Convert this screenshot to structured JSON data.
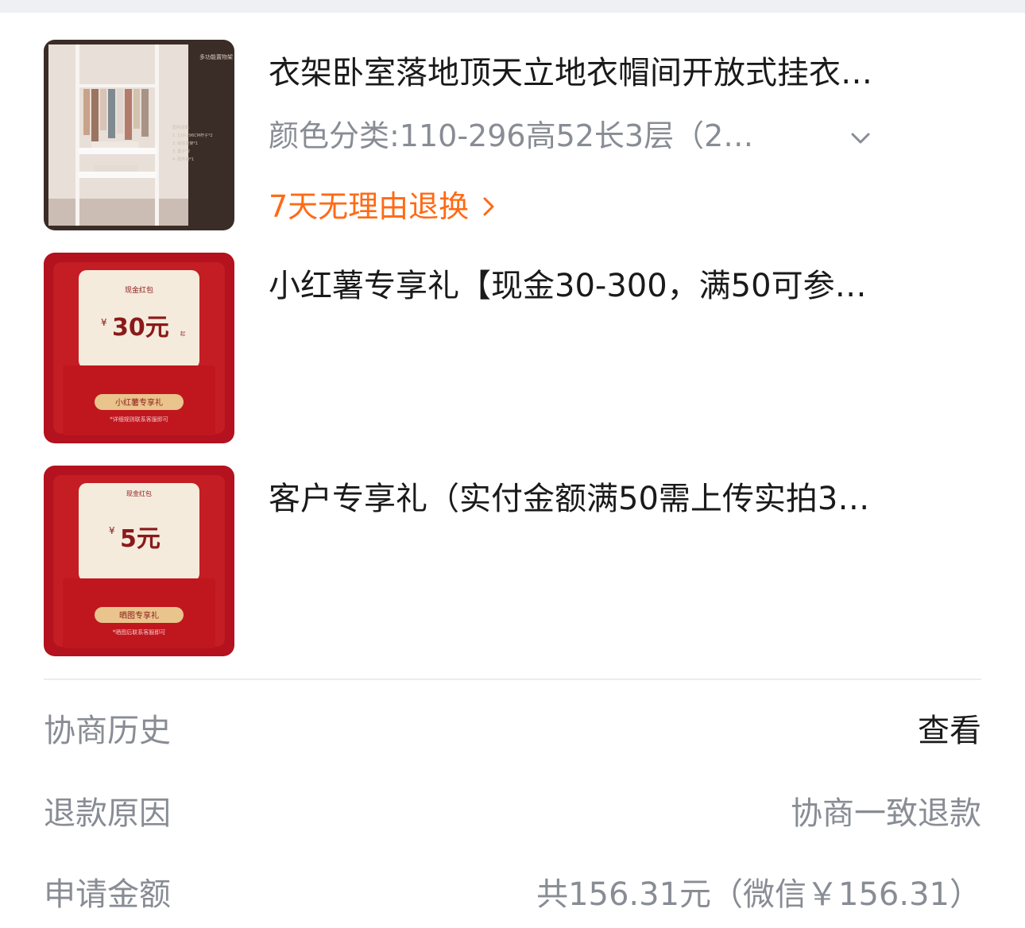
{
  "items": [
    {
      "title": "衣架卧室落地顶天立地衣帽间开放式挂衣…",
      "spec": "颜色分类:110-296高52长3层（2…",
      "policy": "7天无理由退换",
      "thumb": {
        "heading": "多功能置物架",
        "notes": [
          "配件清单:",
          "1. 110-296CM杆子*2",
          "2. 晾衣挂架*1",
          "3. 置子*2",
          "4. 配件袋*1"
        ]
      }
    },
    {
      "title": "小红薯专享礼【现金30-300，满50可参…",
      "thumb": {
        "heading": "现金红包",
        "currency": "¥",
        "amount": "30元",
        "suffix": "起",
        "badge": "小红薯专享礼",
        "note": "*详细规则联系客服即可"
      }
    },
    {
      "title": "客户专享礼（实付金额满50需上传实拍3…",
      "thumb": {
        "heading": "现金红包",
        "currency": "¥",
        "amount": "5元",
        "badge": "晒图专享礼",
        "note": "*晒图后联系客服即可"
      }
    }
  ],
  "details": {
    "history_label": "协商历史",
    "history_action": "查看",
    "reason_label": "退款原因",
    "reason_value": "协商一致退款",
    "amount_label": "申请金额",
    "amount_value": "共156.31元（微信￥156.31）"
  },
  "colors": {
    "accent_orange": "#ff6a14",
    "gift_red": "#b3121e",
    "label_grey": "#888c94"
  },
  "icons": [
    "chevron-down-icon",
    "chevron-right-icon"
  ]
}
